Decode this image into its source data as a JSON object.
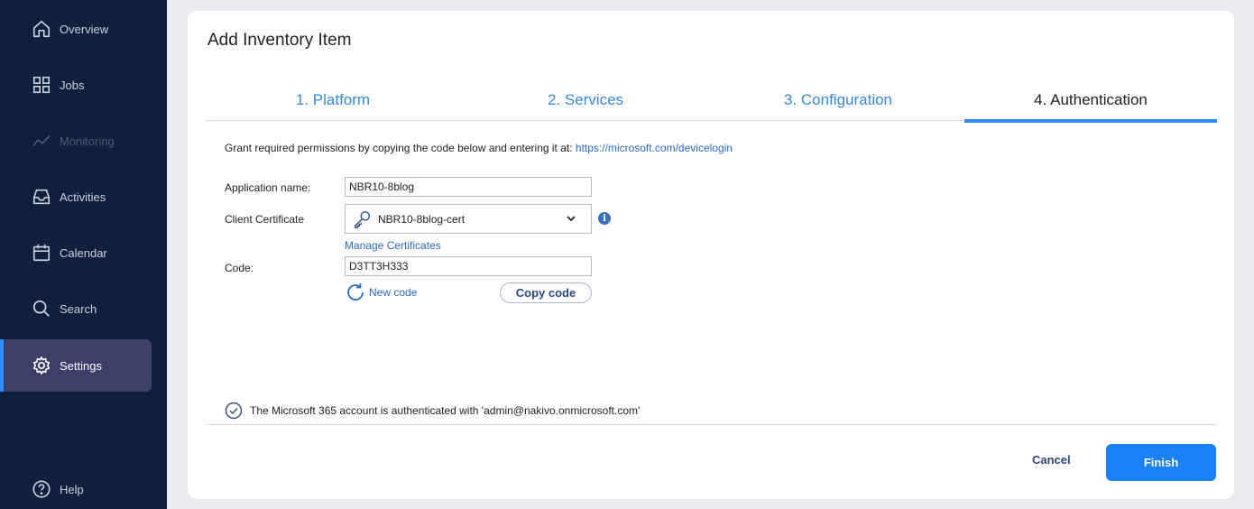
{
  "sidebar": {
    "items": [
      {
        "label": "Overview",
        "icon": "home-icon"
      },
      {
        "label": "Jobs",
        "icon": "grid-icon"
      },
      {
        "label": "Monitoring",
        "icon": "chart-line-icon",
        "disabled": true
      },
      {
        "label": "Activities",
        "icon": "inbox-icon"
      },
      {
        "label": "Calendar",
        "icon": "calendar-icon"
      },
      {
        "label": "Search",
        "icon": "search-icon"
      },
      {
        "label": "Settings",
        "icon": "gear-icon",
        "active": true
      }
    ],
    "help_label": "Help"
  },
  "dialog": {
    "title": "Add Inventory Item",
    "tabs": [
      {
        "label": "1. Platform"
      },
      {
        "label": "2. Services"
      },
      {
        "label": "3. Configuration"
      },
      {
        "label": "4. Authentication",
        "active": true
      }
    ],
    "grant_text": "Grant required permissions by copying the code below and entering it at:",
    "grant_link": "https://microsoft.com/devicelogin",
    "fields": {
      "app_name_label": "Application name:",
      "app_name_value": "NBR10-8blog",
      "cert_label": "Client Certificate",
      "cert_value": "NBR10-8blog-cert",
      "manage_certs": "Manage Certificates",
      "code_label": "Code:",
      "code_value": "D3TT3H333",
      "new_code": "New code",
      "copy_code": "Copy code"
    },
    "status_text": "The Microsoft 365 account is authenticated with 'admin@nakivo.onmicrosoft.com'",
    "cancel_label": "Cancel",
    "finish_label": "Finish"
  },
  "colors": {
    "sidebar_bg": "#0f1f3d",
    "accent": "#1a82f5",
    "link": "#2a6bc0"
  }
}
